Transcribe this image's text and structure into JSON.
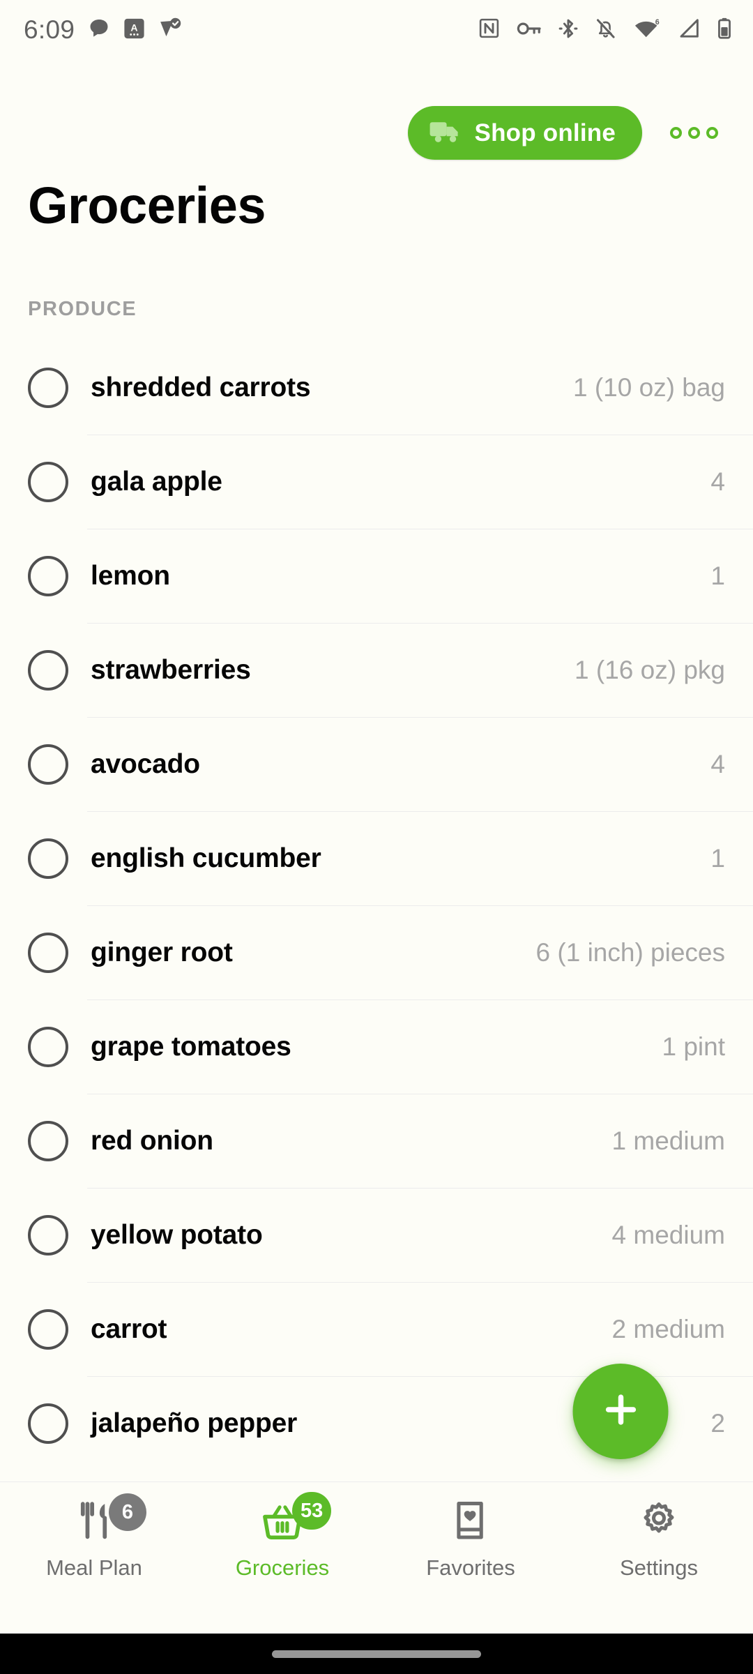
{
  "status_bar": {
    "time": "6:09",
    "left_icons": [
      "chat-bubble-icon",
      "android-auto-icon",
      "location-verified-icon"
    ],
    "right_icons": [
      "nfc-icon",
      "vpn-key-icon",
      "bluetooth-icon",
      "notifications-muted-icon",
      "wifi-icon",
      "cellular-signal-icon",
      "battery-icon"
    ],
    "wifi_generation": "6"
  },
  "header": {
    "shop_online_label": "Shop online",
    "shop_online_icon": "delivery-truck-icon",
    "overflow_icon": "more-options-icon",
    "title": "Groceries",
    "accent_color": "#5cbb28"
  },
  "sections": [
    {
      "label": "PRODUCE",
      "items": [
        {
          "name": "shredded carrots",
          "qty": "1 (10 oz) bag"
        },
        {
          "name": "gala apple",
          "qty": "4"
        },
        {
          "name": "lemon",
          "qty": "1"
        },
        {
          "name": "strawberries",
          "qty": "1 (16 oz) pkg"
        },
        {
          "name": "avocado",
          "qty": "4"
        },
        {
          "name": "english cucumber",
          "qty": "1"
        },
        {
          "name": "ginger root",
          "qty": "6 (1 inch) pieces"
        },
        {
          "name": "grape tomatoes",
          "qty": "1 pint"
        },
        {
          "name": "red onion",
          "qty": "1 medium"
        },
        {
          "name": "yellow potato",
          "qty": "4 medium"
        },
        {
          "name": "carrot",
          "qty": "2 medium"
        },
        {
          "name": "jalapeño pepper",
          "qty": "2"
        }
      ]
    }
  ],
  "fab": {
    "icon": "plus-icon"
  },
  "bottom_nav": [
    {
      "label": "Meal Plan",
      "icon": "fork-knife-icon",
      "badge": "6",
      "active": false
    },
    {
      "label": "Groceries",
      "icon": "shopping-basket-icon",
      "badge": "53",
      "active": true
    },
    {
      "label": "Favorites",
      "icon": "book-heart-icon",
      "badge": null,
      "active": false
    },
    {
      "label": "Settings",
      "icon": "gear-icon",
      "badge": null,
      "active": false
    }
  ]
}
